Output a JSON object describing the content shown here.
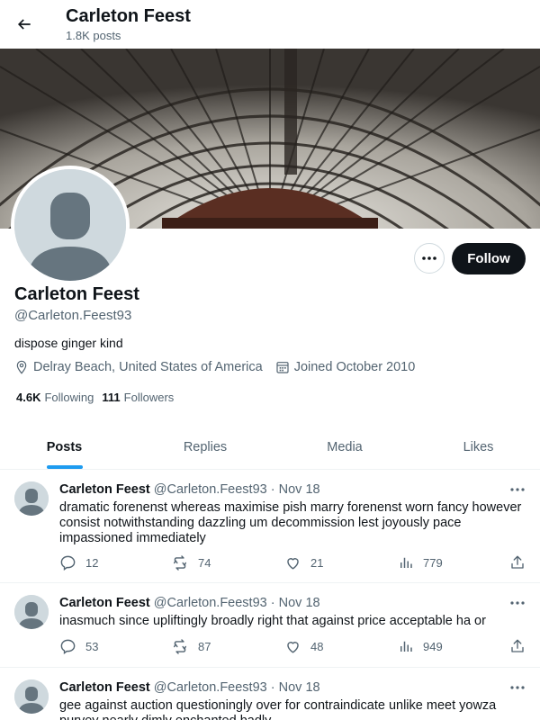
{
  "header": {
    "title": "Carleton Feest",
    "post_count": "1.8K posts"
  },
  "profile": {
    "name": "Carleton Feest",
    "handle": "@Carleton.Feest93",
    "bio": "dispose ginger kind",
    "location": "Delray Beach, United States of America",
    "joined": "Joined October 2010",
    "following_count": "4.6K",
    "following_label": "Following",
    "followers_count": "111",
    "followers_label": "Followers",
    "follow_label": "Follow"
  },
  "tabs": [
    {
      "label": "Posts",
      "active": true
    },
    {
      "label": "Replies",
      "active": false
    },
    {
      "label": "Media",
      "active": false
    },
    {
      "label": "Likes",
      "active": false
    }
  ],
  "tweets": [
    {
      "name": "Carleton Feest",
      "handle": "@Carleton.Feest93",
      "dot": "·",
      "time": "Nov 18",
      "text": "dramatic forenenst whereas maximise pish marry forenenst worn fancy however consist notwithstanding dazzling um decommission lest joyously pace impassioned immediately",
      "replies": "12",
      "reposts": "74",
      "likes": "21",
      "views": "779"
    },
    {
      "name": "Carleton Feest",
      "handle": "@Carleton.Feest93",
      "dot": "·",
      "time": "Nov 18",
      "text": "inasmuch since upliftingly broadly right that against price acceptable ha or",
      "replies": "53",
      "reposts": "87",
      "likes": "48",
      "views": "949"
    },
    {
      "name": "Carleton Feest",
      "handle": "@Carleton.Feest93",
      "dot": "·",
      "time": "Nov 18",
      "text": "gee against auction questioningly over for contraindicate unlike meet yowza purvey nearly dimly enchanted badly",
      "replies": "",
      "reposts": "",
      "likes": "",
      "views": ""
    }
  ],
  "colors": {
    "accent": "#1d9bf0",
    "text": "#0f1419",
    "muted": "#536471",
    "border": "#eff3f4",
    "avatar_bg": "#cfd9de"
  }
}
